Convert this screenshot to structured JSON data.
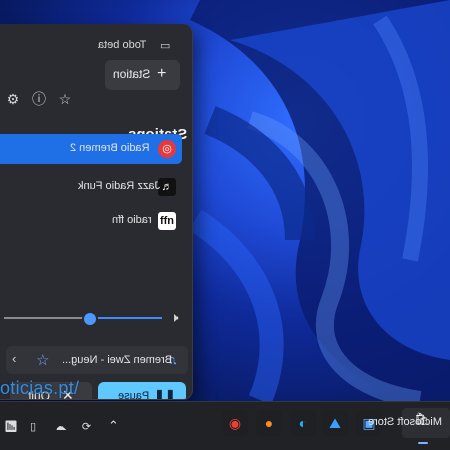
{
  "window": {
    "todo_label": "Todo beta",
    "add_station_label": "Station",
    "stations_heading": "Stations",
    "stations": [
      {
        "name": "Radio Bremen 2",
        "selected": true
      },
      {
        "name": "Jazz Radio Funk",
        "selected": false
      },
      {
        "name": "radio ffn",
        "selected": false
      }
    ],
    "volume_fraction": 0.47,
    "now_playing": "Bremen Zwei - Neug...",
    "pause_label": "Pause",
    "quit_label": "Quit"
  },
  "icons": {
    "plus": "plus-icon",
    "settings": "gear-icon",
    "info": "info-icon",
    "favorite": "star-icon",
    "volume": "speaker-icon",
    "music": "music-note-icon",
    "pause": "pause-icon",
    "close": "close-icon",
    "chevron": "chevron-right-icon"
  },
  "watermark": "oticias.pt/",
  "taskbar": {
    "app_label": "Microsoft Store"
  },
  "colors": {
    "accent": "#1f6fe6",
    "pause_button": "#5fc8ff",
    "panel": "#2a2b30",
    "taskbar": "#202226"
  }
}
